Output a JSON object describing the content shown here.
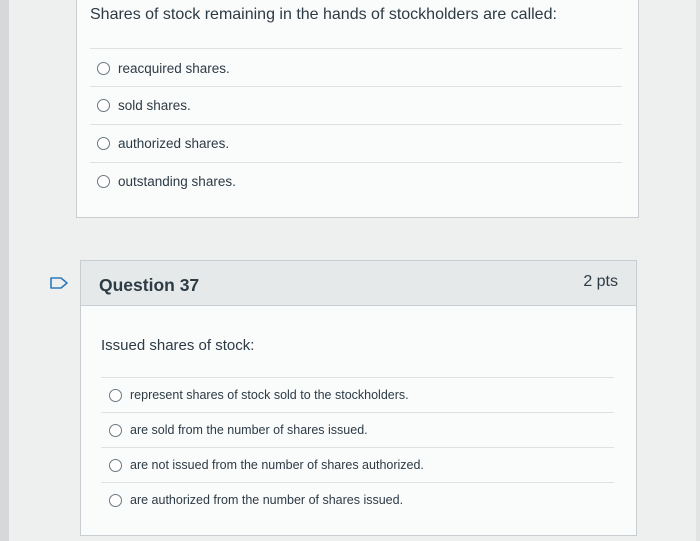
{
  "question_prev": {
    "prompt": "Shares of stock remaining in the hands of stockholders are called:",
    "answers": [
      "reacquired shares.",
      "sold shares.",
      "authorized shares.",
      "outstanding shares."
    ]
  },
  "question_37": {
    "title": "Question 37",
    "points": "2 pts",
    "prompt": "Issued shares of stock:",
    "answers": [
      "represent shares of stock sold to the stockholders.",
      "are sold from the number of shares issued.",
      "are not issued from the number of shares authorized.",
      "are authorized from the number of shares issued."
    ]
  },
  "icons": {
    "flag": "flag-outline-icon",
    "radio": "radio-unselected-icon"
  },
  "colors": {
    "text": "#2d3b45",
    "header_bg": "#e6e9ea",
    "card_bg": "#fafbfb",
    "flag": "#2b7abc"
  }
}
